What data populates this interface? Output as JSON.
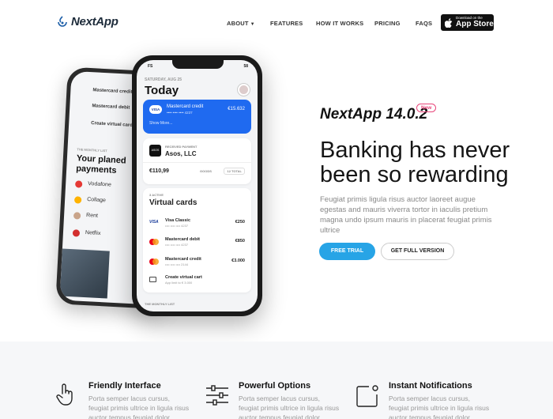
{
  "nav": {
    "brand": "NextApp",
    "items": [
      "ABOUT",
      "FEATURES",
      "HOW IT WORKS",
      "PRICING",
      "FAQS"
    ],
    "appstore_small": "Download on the",
    "appstore_big": "App Store"
  },
  "phone": {
    "carrier": "FS",
    "battery": "58",
    "date": "SATURDAY, AUG 25",
    "title": "Today",
    "card": {
      "brand": "VISA",
      "name": "Mastercard credit",
      "number": "•••• •••• •••• 4237",
      "amount": "€15.632",
      "more": "Show More..."
    },
    "payment": {
      "logo": "ASOS",
      "label": "RECEIVED PAYMENT",
      "merchant": "Asos, LLC",
      "amount": "€110,99",
      "tag1": "GOODS",
      "tag2": "12 TOTAL"
    },
    "virtual": {
      "count_label": "3 ACTIVE",
      "title": "Virtual cards",
      "cards": [
        {
          "name": "Visa Classic",
          "number": "•••• •••• •••• 4237",
          "amount": "€250"
        },
        {
          "name": "Mastercard debit",
          "number": "•••• •••• •••• 4237",
          "amount": "€850"
        },
        {
          "name": "Mastercard credit",
          "number": "•••• •••• •••• 2144",
          "amount": "€3.000"
        }
      ],
      "create": "Create virtual cart",
      "create_sub": "App limit to € 3.000"
    },
    "footer": "THE MONTHLY LIST"
  },
  "phone_back": {
    "rows": [
      "Mastercard credit",
      "Mastercard debit",
      "Create virtual card"
    ],
    "list_label": "THE MONTHLY LIST",
    "heading1": "Your planed",
    "heading2": "payments",
    "items": [
      "Vodafone",
      "Collage",
      "Rent",
      "Netflix"
    ]
  },
  "hero": {
    "version": "NextApp 14.0.2",
    "badge": "New",
    "headline": "Banking has never been so rewarding",
    "description": "Feugiat primis ligula risus auctor laoreet augue egestas and mauris viverra tortor in iaculis pretium magna undo ipsum mauris in placerat feugiat primis ultrice",
    "cta_primary": "FREE TRIAL",
    "cta_secondary": "GET FULL VERSION"
  },
  "features": [
    {
      "title": "Friendly Interface",
      "text": "Porta semper lacus cursus, feugiat primis ultrice in ligula risus auctor tempus feugiat dolor impedit felis"
    },
    {
      "title": "Powerful Options",
      "text": "Porta semper lacus cursus, feugiat primis ultrice in ligula risus auctor tempus feugiat dolor impedit felis"
    },
    {
      "title": "Instant Notifications",
      "text": "Porta semper lacus cursus, feugiat primis ultrice in ligula risus auctor tempus feugiat dolor impedit felis"
    }
  ],
  "colors": {
    "primary": "#27a4e6",
    "card_blue": "#1f6af0",
    "badge": "#e8457a"
  }
}
